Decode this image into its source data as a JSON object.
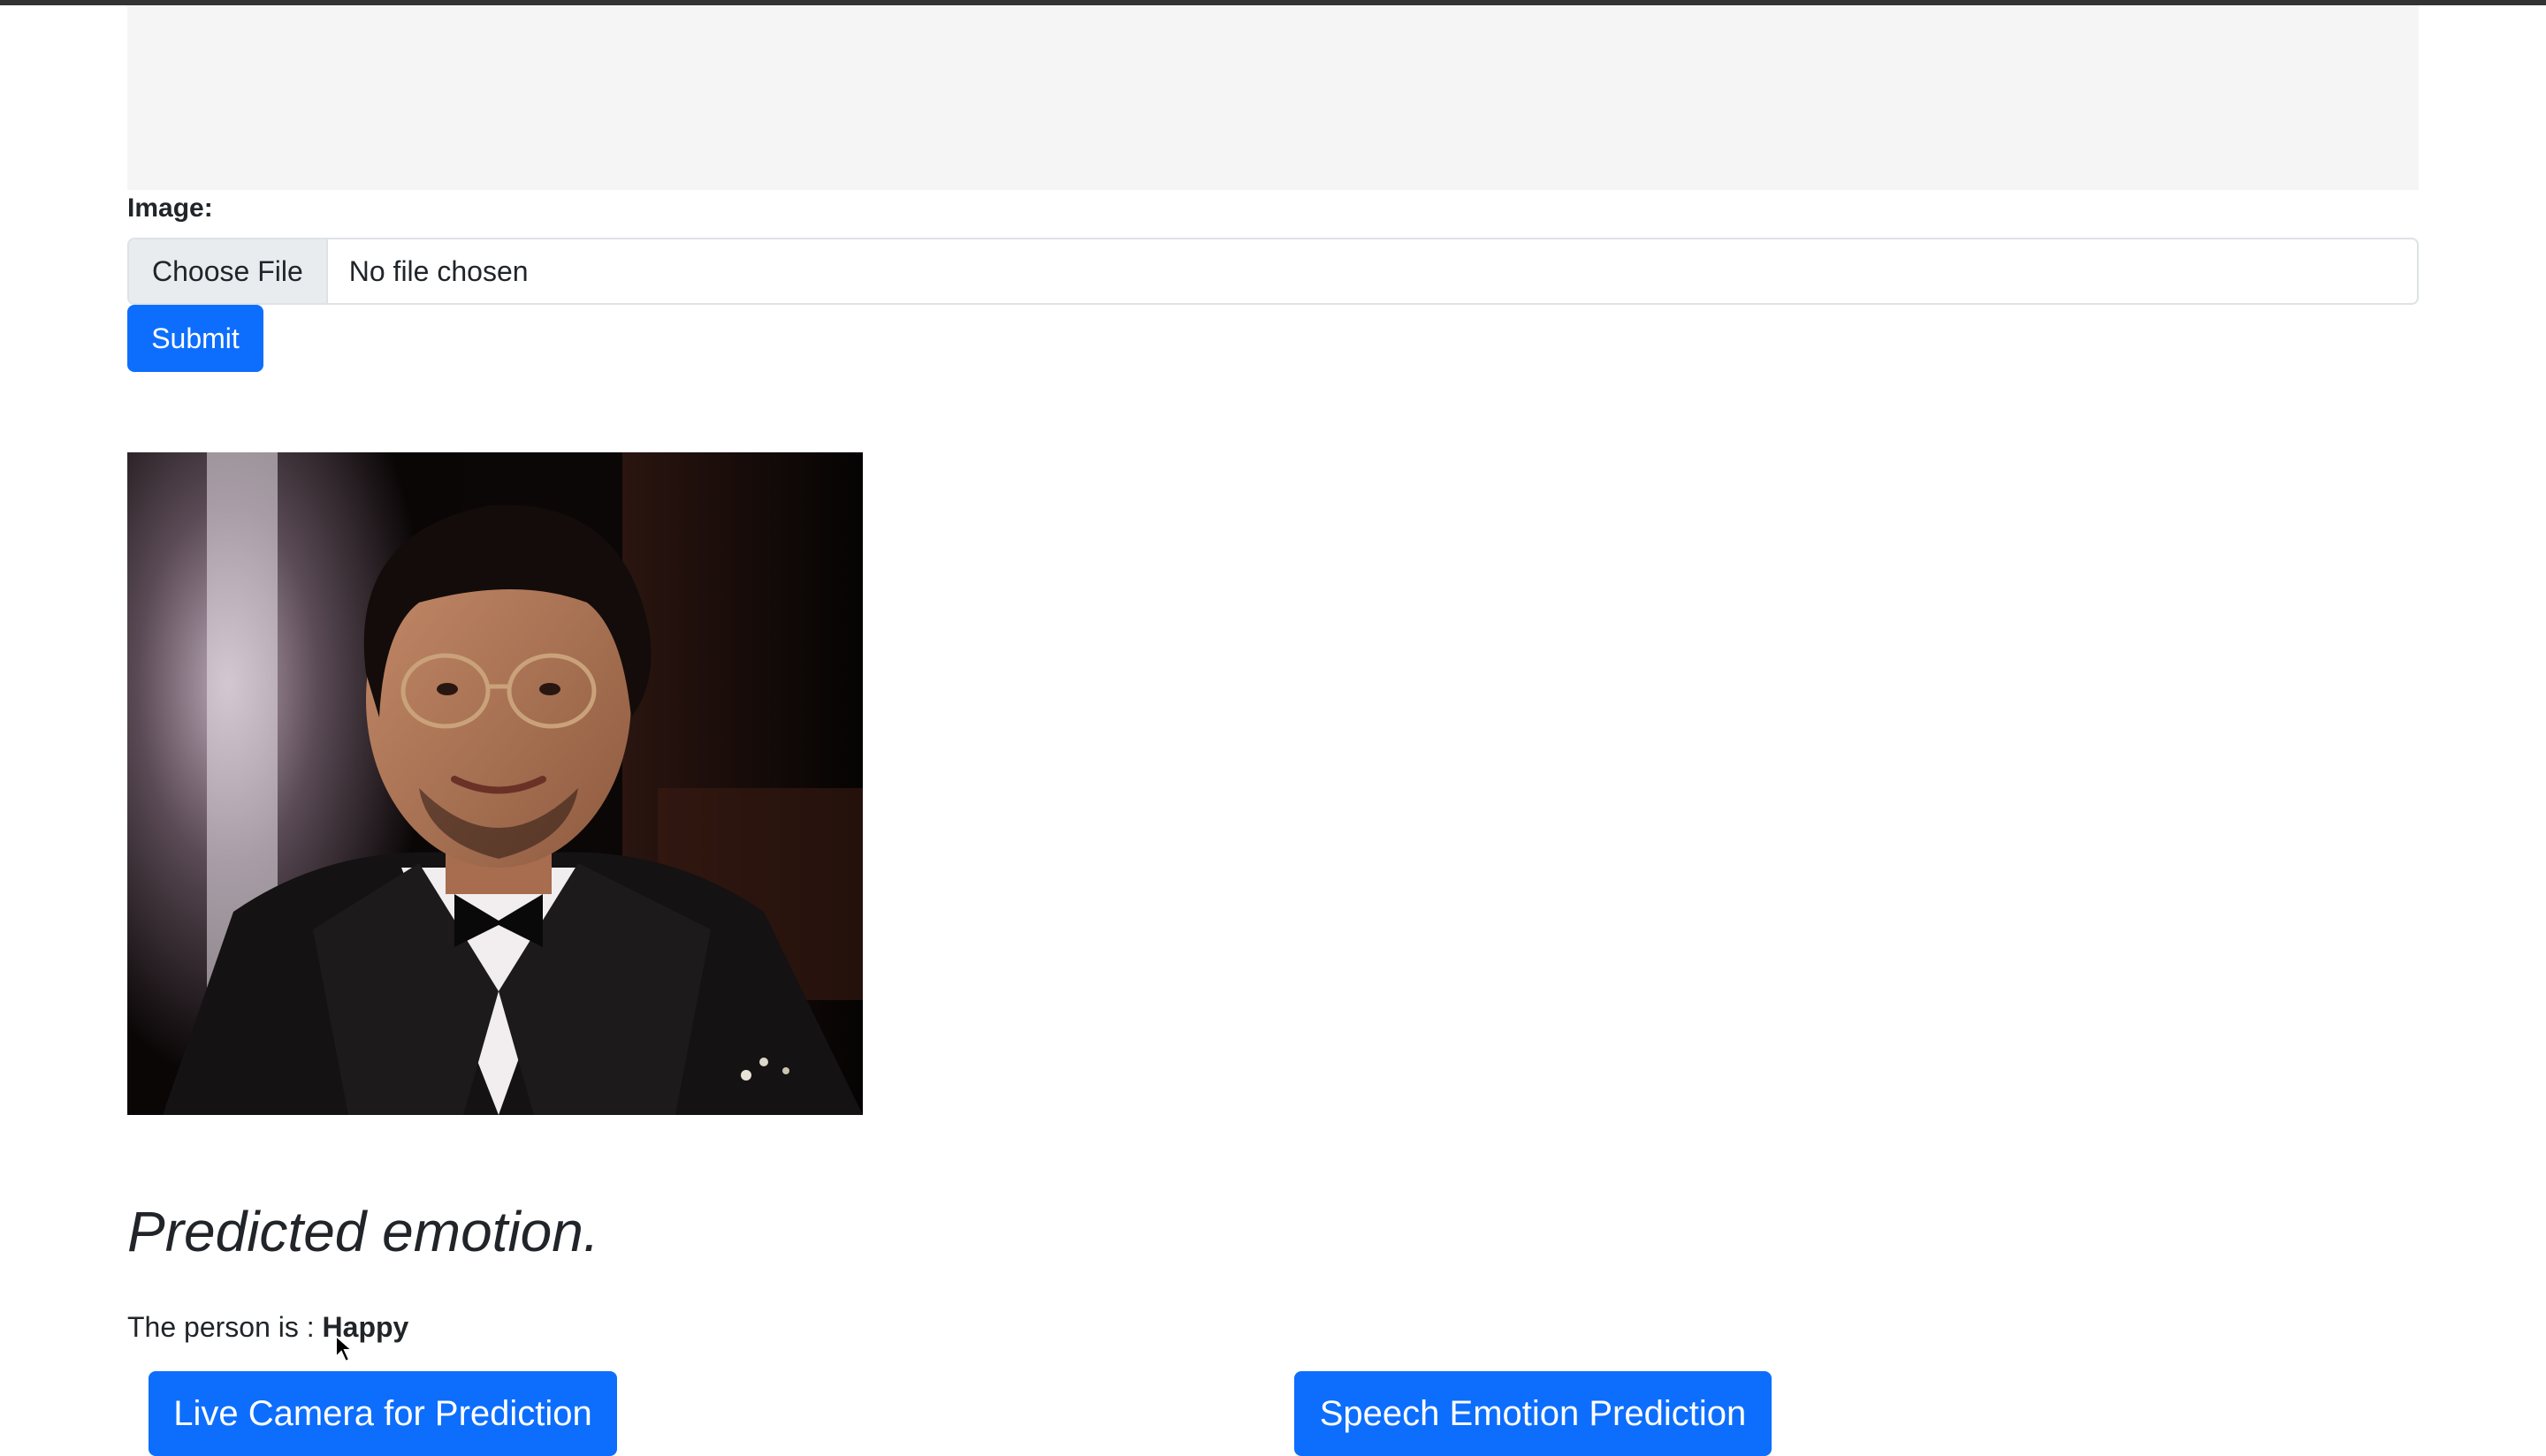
{
  "form": {
    "image_label": "Image:",
    "choose_file_label": "Choose File",
    "file_status": "No file chosen",
    "submit_label": "Submit"
  },
  "preview": {
    "image_icon": "portrait-photo"
  },
  "result": {
    "heading": "Predicted emotion.",
    "prefix": "The person is :",
    "emotion": "Happy"
  },
  "actions": {
    "live_camera_label": "Live Camera for Prediction",
    "speech_label": "Speech Emotion Prediction"
  },
  "colors": {
    "primary": "#0d6efd",
    "jumbotron_bg": "#f5f5f5"
  }
}
